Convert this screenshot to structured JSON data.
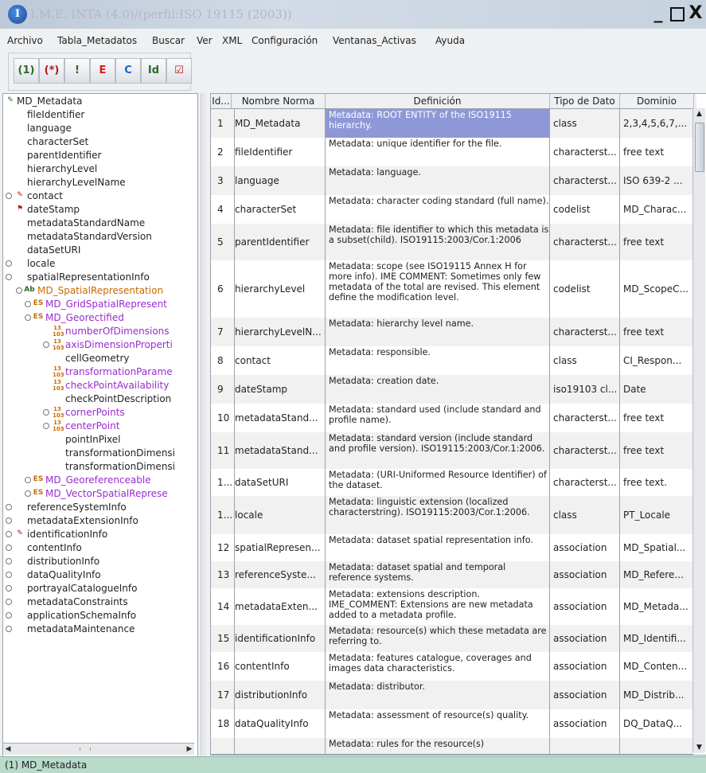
{
  "window": {
    "title": "I.M.E. INTA (4.0)/(perfil:ISO 19115 (2003))",
    "app_icon": "I",
    "minimize": "_",
    "close": "X"
  },
  "menu": [
    "Archivo",
    "Tabla_Metadatos",
    "Buscar",
    "Ver",
    "XML",
    "Configuración",
    "Ventanas_Activas",
    "Ayuda"
  ],
  "toolbar": {
    "buttons": [
      {
        "icon": "tree-one-icon",
        "label": "(1)"
      },
      {
        "icon": "tree-all-icon",
        "label": "(*)"
      },
      {
        "icon": "tree-mandatory-icon",
        "label": "!"
      },
      {
        "icon": "virus-e-icon",
        "label": "E"
      },
      {
        "icon": "crosshair-c-icon",
        "label": "C"
      },
      {
        "icon": "people-id-icon",
        "label": "Id"
      },
      {
        "icon": "tree-checked-icon",
        "label": "☑"
      }
    ]
  },
  "tree": {
    "root": "MD_Metadata",
    "items": [
      {
        "label": "fileIdentifier"
      },
      {
        "label": "language"
      },
      {
        "label": "characterSet"
      },
      {
        "label": "parentIdentifier"
      },
      {
        "label": "hierarchyLevel"
      },
      {
        "label": "hierarchyLevelName"
      },
      {
        "label": "contact"
      },
      {
        "label": "dateStamp"
      },
      {
        "label": "metadataStandardName"
      },
      {
        "label": "metadataStandardVersion"
      },
      {
        "label": "dataSetURI"
      },
      {
        "label": "locale"
      },
      {
        "label": "spatialRepresentationInfo"
      },
      {
        "label": "MD_SpatialRepresentation",
        "badge": "Ab"
      },
      {
        "label": "MD_GridSpatialRepresent",
        "badge": "ES"
      },
      {
        "label": "MD_Georectified",
        "badge": "ES"
      },
      {
        "label": "numberOfDimensions",
        "badge": "13 103"
      },
      {
        "label": "axisDimensionProperti",
        "badge": "13 103"
      },
      {
        "label": "cellGeometry"
      },
      {
        "label": "transformationParame",
        "badge": "13 103"
      },
      {
        "label": "checkPointAvailability",
        "badge": "13 103"
      },
      {
        "label": "checkPointDescription"
      },
      {
        "label": "cornerPoints",
        "badge": "13 103"
      },
      {
        "label": "centerPoint",
        "badge": "13 103"
      },
      {
        "label": "pointInPixel"
      },
      {
        "label": "transformationDimensi"
      },
      {
        "label": "transformationDimensi"
      },
      {
        "label": "MD_Georeferenceable",
        "badge": "ES"
      },
      {
        "label": "MD_VectorSpatialReprese",
        "badge": "ES"
      },
      {
        "label": "referenceSystemInfo"
      },
      {
        "label": "metadataExtensionInfo"
      },
      {
        "label": "identificationInfo"
      },
      {
        "label": "contentInfo"
      },
      {
        "label": "distributionInfo"
      },
      {
        "label": "dataQualityInfo"
      },
      {
        "label": "portrayalCatalogueInfo"
      },
      {
        "label": "metadataConstraints"
      },
      {
        "label": "applicationSchemaInfo"
      },
      {
        "label": "metadataMaintenance"
      }
    ]
  },
  "table": {
    "columns": [
      "Id...",
      "Nombre Norma",
      "Definición",
      "Tipo de Dato",
      "Dominio"
    ],
    "rows": [
      {
        "id": "1",
        "name": "MD_Metadata",
        "def": "Metadata: ROOT ENTITY of the ISO19115 hierarchy.",
        "type": "class",
        "domain": "2,3,4,5,6,7,..."
      },
      {
        "id": "2",
        "name": "fileIdentifier",
        "def": "Metadata: unique identifier for the file.",
        "type": "characterst...",
        "domain": "free text"
      },
      {
        "id": "3",
        "name": "language",
        "def": "Metadata: language.",
        "type": "characterst...",
        "domain": "ISO 639-2 ..."
      },
      {
        "id": "4",
        "name": "characterSet",
        "def": "Metadata: character coding standard (full name).",
        "type": "codelist",
        "domain": "MD_Charac..."
      },
      {
        "id": "5",
        "name": "parentIdentifier",
        "def": "Metadata: file identifier to which this metadata is a subset(child). ISO19115:2003/Cor.1:2006",
        "type": "characterst...",
        "domain": "free text"
      },
      {
        "id": "6",
        "name": "hierarchyLevel",
        "def": "Metadata: scope (see ISO19115 Annex H for more info). IME COMMENT: Sometimes only few metadata of the total are revised. This element define the modification level.",
        "type": "codelist",
        "domain": "MD_ScopeC..."
      },
      {
        "id": "7",
        "name": "hierarchyLevelN...",
        "def": "Metadata: hierarchy level name.",
        "type": "characterst...",
        "domain": "free text"
      },
      {
        "id": "8",
        "name": "contact",
        "def": "Metadata: responsible.",
        "type": "class",
        "domain": "CI_Respon..."
      },
      {
        "id": "9",
        "name": "dateStamp",
        "def": "Metadata: creation date.",
        "type": "iso19103 cl...",
        "domain": "Date"
      },
      {
        "id": "10",
        "name": "metadataStand...",
        "def": "Metadata: standard used (include standard and profile name).",
        "type": "characterst...",
        "domain": "free text"
      },
      {
        "id": "11",
        "name": "metadataStand...",
        "def": "Metadata: standard version (include standard and profile version). ISO19115:2003/Cor.1:2006.",
        "type": "characterst...",
        "domain": "free text"
      },
      {
        "id": "1...",
        "name": "dataSetURI",
        "def": "Metadata: (URI-Uniformed Resource Identifier) of the dataset.",
        "type": "characterst...",
        "domain": "free text."
      },
      {
        "id": "1...",
        "name": "locale",
        "def": "Metadata: linguistic extension (localized characterstring). ISO19115:2003/Cor.1:2006.",
        "type": "class",
        "domain": "PT_Locale"
      },
      {
        "id": "12",
        "name": "spatialRepresen...",
        "def": "Metadata: dataset spatial representation info.",
        "type": "association",
        "domain": "MD_Spatial..."
      },
      {
        "id": "13",
        "name": "referenceSyste...",
        "def": "Metadata: dataset spatial and temporal reference systems.",
        "type": "association",
        "domain": "MD_Refere..."
      },
      {
        "id": "14",
        "name": "metadataExten...",
        "def": "Metadata: extensions description. IME_COMMENT: Extensions are new metadata added to a metadata profile.",
        "type": "association",
        "domain": "MD_Metada..."
      },
      {
        "id": "15",
        "name": "identificationInfo",
        "def": "Metadata: resource(s) which these metadata are referring to.",
        "type": "association",
        "domain": "MD_Identifi..."
      },
      {
        "id": "16",
        "name": "contentInfo",
        "def": "Metadata: features catalogue, coverages and images data characteristics.",
        "type": "association",
        "domain": "MD_Conten..."
      },
      {
        "id": "17",
        "name": "distributionInfo",
        "def": "Metadata: distributor.",
        "type": "association",
        "domain": "MD_Distrib..."
      },
      {
        "id": "18",
        "name": "dataQualityInfo",
        "def": "Metadata: assessment of resource(s) quality.",
        "type": "association",
        "domain": "DQ_DataQ..."
      },
      {
        "id": "",
        "name": "",
        "def": "Metadata: rules for the resource(s)",
        "type": "",
        "domain": ""
      }
    ]
  },
  "status": "(1) MD_Metadata"
}
